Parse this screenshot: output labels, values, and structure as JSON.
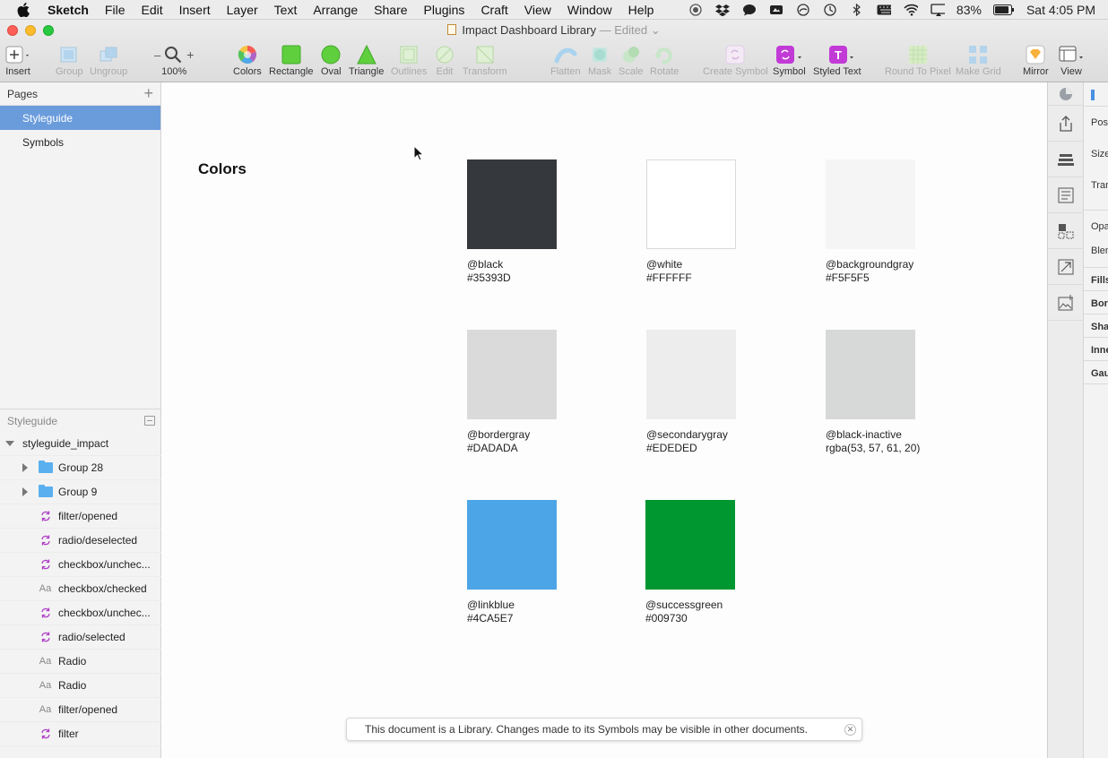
{
  "menubar": {
    "app": "Sketch",
    "items": [
      "File",
      "Edit",
      "Insert",
      "Layer",
      "Text",
      "Arrange",
      "Share",
      "Plugins",
      "Craft",
      "View",
      "Window",
      "Help"
    ],
    "battery": "83%",
    "clock": "Sat 4:05 PM"
  },
  "window": {
    "title": "Impact Dashboard Library",
    "edited": "— Edited"
  },
  "toolbar": {
    "insert": "Insert",
    "group": "Group",
    "ungroup": "Ungroup",
    "zoom_minus": "–",
    "zoom_plus": "+",
    "zoom": "100%",
    "colors": "Colors",
    "rectangle": "Rectangle",
    "oval": "Oval",
    "triangle": "Triangle",
    "outlines": "Outlines",
    "edit": "Edit",
    "transform": "Transform",
    "flatten": "Flatten",
    "mask": "Mask",
    "scale": "Scale",
    "rotate": "Rotate",
    "create_symbol": "Create Symbol",
    "symbol": "Symbol",
    "styled_text": "Styled Text",
    "round_to_pixel": "Round To Pixel",
    "make_grid": "Make Grid",
    "mirror": "Mirror",
    "view": "View"
  },
  "sidebar": {
    "pages_header": "Pages",
    "pages": [
      "Styleguide",
      "Symbols"
    ],
    "layers_header": "Styleguide",
    "root_layer": "styleguide_impact",
    "layers": [
      {
        "name": "Group 28",
        "kind": "folder"
      },
      {
        "name": "Group 9",
        "kind": "folder"
      },
      {
        "name": "filter/opened",
        "kind": "symbol"
      },
      {
        "name": "radio/deselected",
        "kind": "symbol"
      },
      {
        "name": "checkbox/unchec...",
        "kind": "symbol"
      },
      {
        "name": "checkbox/checked",
        "kind": "text"
      },
      {
        "name": "checkbox/unchec...",
        "kind": "symbol"
      },
      {
        "name": "radio/selected",
        "kind": "symbol"
      },
      {
        "name": "Radio",
        "kind": "text"
      },
      {
        "name": "Radio",
        "kind": "text"
      },
      {
        "name": "filter/opened",
        "kind": "text"
      },
      {
        "name": "filter",
        "kind": "symbol"
      }
    ]
  },
  "canvas": {
    "section_title": "Colors",
    "swatches": [
      {
        "name": "@black",
        "value": "#35393D",
        "color": "#35393D"
      },
      {
        "name": "@white",
        "value": "#FFFFFF",
        "color": "#FFFFFF"
      },
      {
        "name": "@backgroundgray",
        "value": "#F5F5F5",
        "color": "#F5F5F5"
      },
      {
        "name": "@bordergray",
        "value": "#DADADA",
        "color": "#DADADA"
      },
      {
        "name": "@secondarygray",
        "value": "#EDEDED",
        "color": "#EDEDED"
      },
      {
        "name": "@black-inactive",
        "value": "rgba(53, 57, 61, 20)",
        "color": "#D7D8D8"
      },
      {
        "name": "@linkblue",
        "value": "#4CA5E7",
        "color": "#4CA5E7"
      },
      {
        "name": "@successgreen",
        "value": "#009730",
        "color": "#009730"
      }
    ],
    "toast": "This document is a Library. Changes made to its Symbols may be visible in other documents."
  },
  "inspector": {
    "rows": [
      "Pos",
      "Size",
      "Tran",
      "Opa",
      "Blen",
      "Fills",
      "Bor",
      "Sha",
      "Inne",
      "Gau"
    ]
  }
}
